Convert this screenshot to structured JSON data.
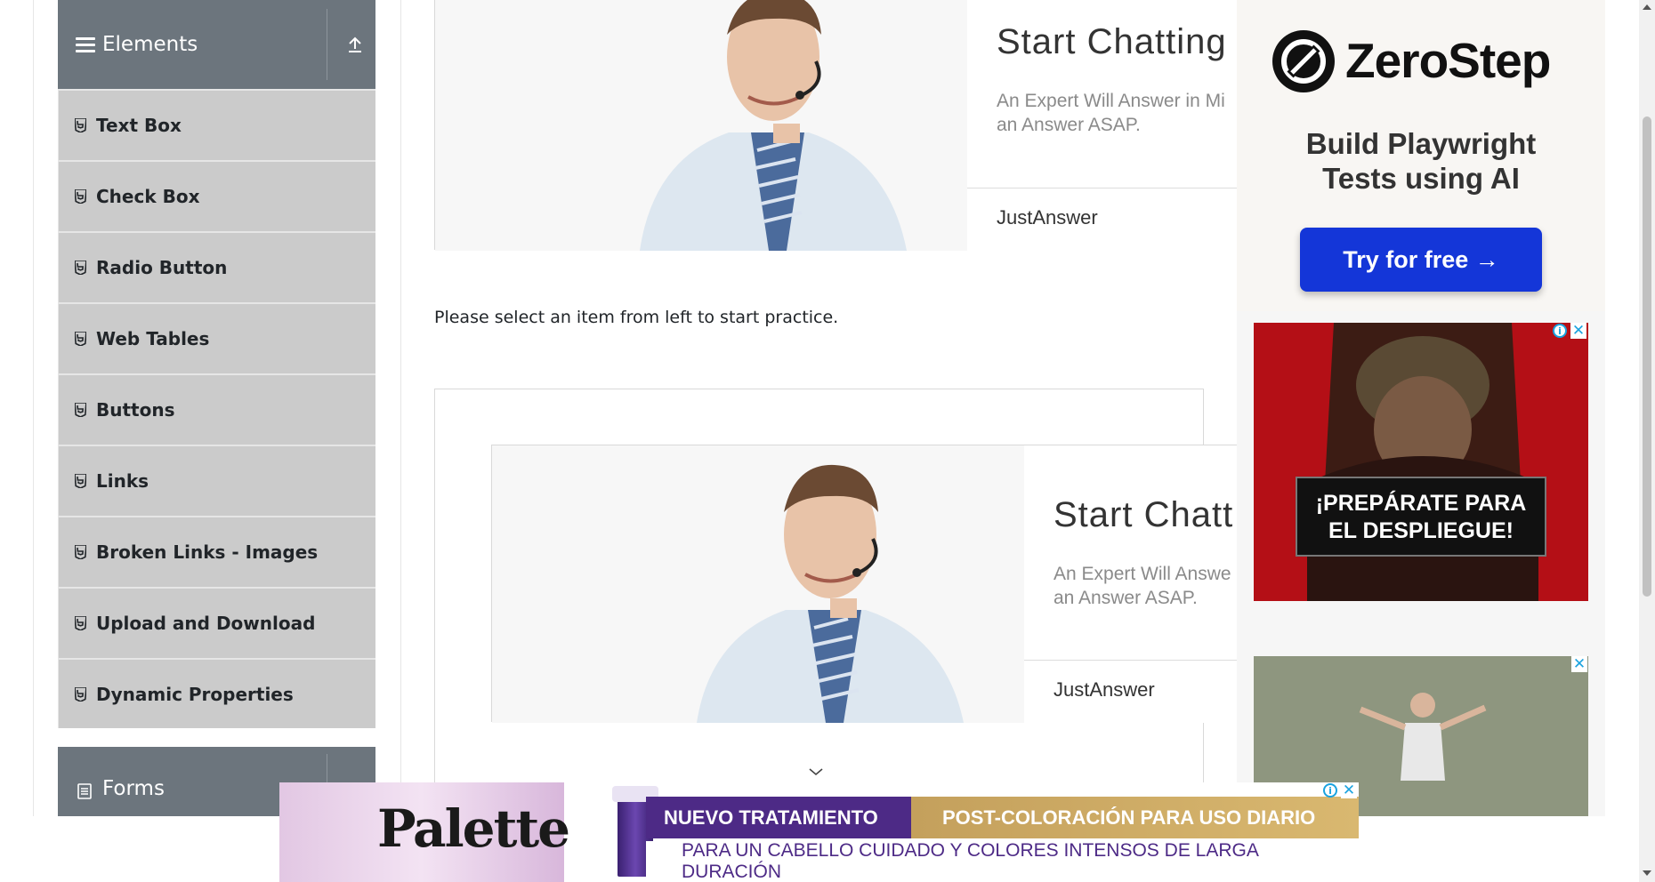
{
  "sidebar": {
    "elements_group": {
      "title": "Elements"
    },
    "items": [
      {
        "label": "Text Box"
      },
      {
        "label": "Check Box"
      },
      {
        "label": "Radio Button"
      },
      {
        "label": "Web Tables"
      },
      {
        "label": "Buttons"
      },
      {
        "label": "Links"
      },
      {
        "label": "Broken Links - Images"
      },
      {
        "label": "Upload and Download"
      },
      {
        "label": "Dynamic Properties"
      }
    ],
    "forms_group": {
      "title": "Forms"
    }
  },
  "main": {
    "ad_top": {
      "title": "Start Chatting",
      "desc_line1": "An Expert Will Answer in Mi",
      "desc_line2": "an Answer ASAP.",
      "brand": "JustAnswer"
    },
    "practice_text": "Please select an item from left to start practice.",
    "ad_second": {
      "title": "Start Chatt",
      "desc_line1": "An Expert Will Answe",
      "desc_line2": "an Answer ASAP.",
      "brand": "JustAnswer"
    }
  },
  "right_ads": {
    "zerostep": {
      "name": "ZeroStep",
      "tagline_line1": "Build Playwright",
      "tagline_line2": "Tests using AI",
      "cta": "Try for free →"
    },
    "military": {
      "line1": "¡PREPÁRATE PARA",
      "line2": "EL DESPLIEGUE!"
    }
  },
  "bottom_ad": {
    "brand": "Palette",
    "line1_left": "NUEVO TRATAMIENTO",
    "line1_right": "POST-COLORACIÓN PARA USO DIARIO",
    "line2": "PARA UN CABELLO CUIDADO Y COLORES INTENSOS DE LARGA DURACIÓN"
  },
  "colors": {
    "sidebar_header": "#6c757d",
    "menu_item": "#cbcbcb",
    "zerostep_button": "#1436d8",
    "military_bg": "#c8101a",
    "palette_purple": "#4d2a86"
  }
}
